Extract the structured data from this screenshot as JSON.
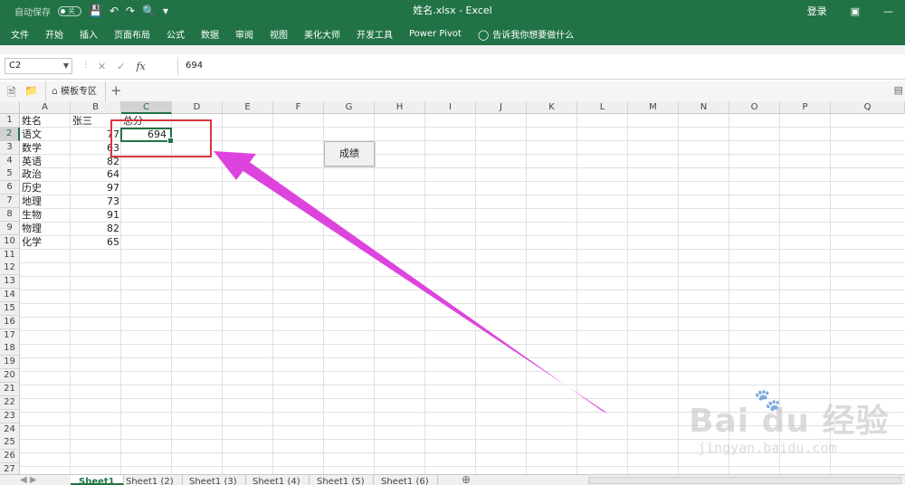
{
  "window": {
    "title": "姓名.xlsx  -  Excel",
    "autosave_label": "自动保存",
    "autosave_state": "关",
    "login": "登录"
  },
  "ribbon": {
    "tabs": [
      "文件",
      "开始",
      "插入",
      "页面布局",
      "公式",
      "数据",
      "审阅",
      "视图",
      "美化大师",
      "开发工具",
      "Power Pivot"
    ],
    "tell_me": "告诉我你想要做什么"
  },
  "formula_bar": {
    "name_box": "C2",
    "fx": "fx",
    "value": "694"
  },
  "doc_tabs": {
    "template_tab": "模板专区",
    "add": "+"
  },
  "sheet": {
    "columns": [
      "A",
      "B",
      "C",
      "D",
      "E",
      "F",
      "G",
      "H",
      "I",
      "J",
      "K",
      "L",
      "M",
      "N",
      "O",
      "P",
      "Q"
    ],
    "active_column": "C",
    "rows": [
      "1",
      "2",
      "3",
      "4",
      "5",
      "6",
      "7",
      "8",
      "9",
      "10",
      "11",
      "12",
      "13",
      "14",
      "15",
      "16",
      "17",
      "18",
      "19",
      "20",
      "21",
      "22",
      "23",
      "24",
      "25",
      "26",
      "27"
    ],
    "active_row": "2",
    "cells": {
      "A1": "姓名",
      "B1": "张三",
      "C1": "总分",
      "A2": "语文",
      "B2": "77",
      "A3": "数学",
      "B3": "63",
      "A4": "英语",
      "B4": "82",
      "A5": "政治",
      "B5": "64",
      "A6": "历史",
      "B6": "97",
      "A7": "地理",
      "B7": "73",
      "A8": "生物",
      "B8": "91",
      "A9": "物理",
      "B9": "82",
      "A10": "化学",
      "B10": "65"
    },
    "selected_cell": {
      "ref": "C2",
      "value": "694"
    },
    "button_label": "成绩",
    "annotation_color": "#d9363e",
    "arrow_color": "#dd44dd"
  },
  "sheet_tabs": [
    "Sheet1",
    "Sheet1 (2)",
    "Sheet1 (3)",
    "Sheet1 (4)",
    "Sheet1 (5)",
    "Sheet1 (6)"
  ],
  "active_sheet": "Sheet1",
  "watermark": {
    "logo": "Bai du 经验",
    "url": "jingyan.baidu.com"
  },
  "theme": {
    "accent": "#217346"
  }
}
